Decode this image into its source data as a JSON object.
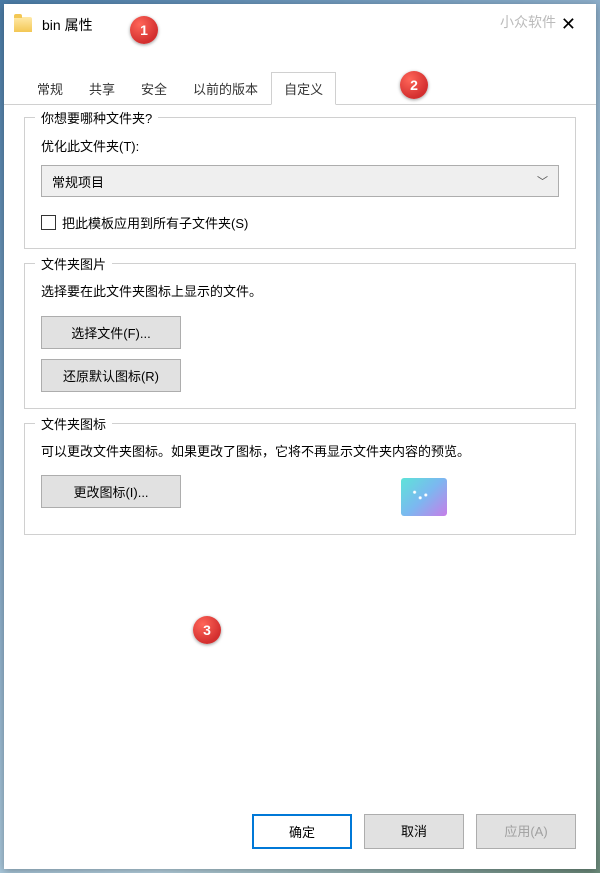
{
  "titlebar": {
    "title": "bin 属性",
    "watermark": "小众软件"
  },
  "callouts": [
    "1",
    "2",
    "3"
  ],
  "tabs": {
    "items": [
      {
        "label": "常规"
      },
      {
        "label": "共享"
      },
      {
        "label": "安全"
      },
      {
        "label": "以前的版本"
      },
      {
        "label": "自定义"
      }
    ]
  },
  "groups": {
    "folderType": {
      "legend": "你想要哪种文件夹?",
      "optimizeLabel": "优化此文件夹(T):",
      "selectValue": "常规项目",
      "checkboxLabel": "把此模板应用到所有子文件夹(S)"
    },
    "folderPicture": {
      "legend": "文件夹图片",
      "description": "选择要在此文件夹图标上显示的文件。",
      "selectFileBtn": "选择文件(F)...",
      "restoreDefaultBtn": "还原默认图标(R)"
    },
    "folderIcon": {
      "legend": "文件夹图标",
      "description": "可以更改文件夹图标。如果更改了图标，它将不再显示文件夹内容的预览。",
      "changeIconBtn": "更改图标(I)..."
    }
  },
  "footer": {
    "ok": "确定",
    "cancel": "取消",
    "apply": "应用(A)"
  }
}
